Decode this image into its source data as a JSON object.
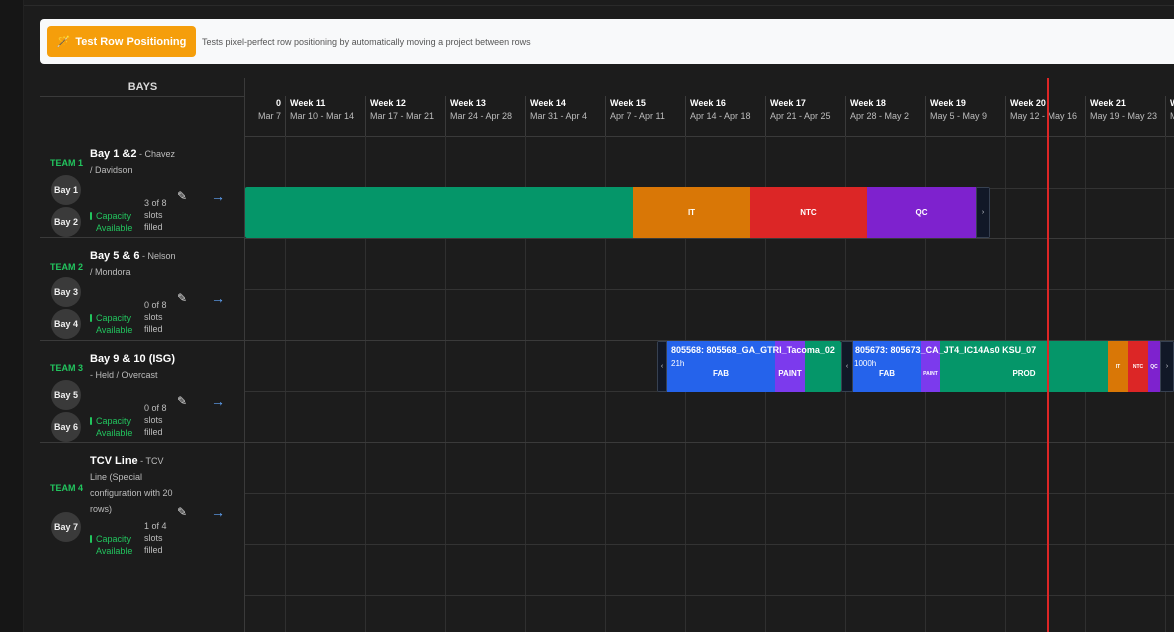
{
  "toolbar": {
    "test_button_label": "Test Row Positioning",
    "test_button_icon": "wand-icon",
    "description": "Tests pixel-perfect row positioning by automatically moving a project between rows"
  },
  "bays_header": "BAYS",
  "weeks": [
    {
      "label": "0",
      "range": "Mar 7"
    },
    {
      "label": "Week 11",
      "range": "Mar 10 - Mar 14"
    },
    {
      "label": "Week 12",
      "range": "Mar 17 - Mar 21"
    },
    {
      "label": "Week 13",
      "range": "Mar 24 - Apr 28"
    },
    {
      "label": "Week 14",
      "range": "Mar 31 - Apr 4"
    },
    {
      "label": "Week 15",
      "range": "Apr 7 - Apr 11"
    },
    {
      "label": "Week 16",
      "range": "Apr 14 - Apr 18"
    },
    {
      "label": "Week 17",
      "range": "Apr 21 - Apr 25"
    },
    {
      "label": "Week 18",
      "range": "Apr 28 - May 2"
    },
    {
      "label": "Week 19",
      "range": "May 5 - May 9"
    },
    {
      "label": "Week 20",
      "range": "May 12 - May 16"
    },
    {
      "label": "Week 21",
      "range": "May 19 - May 23"
    },
    {
      "label": "W",
      "range": "M"
    }
  ],
  "teams": [
    {
      "team": "TEAM 1",
      "bay_name": "Bay 1 &2",
      "bay_desc": "Chavez / Davidson",
      "bays": [
        "Bay 1",
        "Bay 2"
      ],
      "capacity": "Capacity Available",
      "slots": "3 of 8 slots filled"
    },
    {
      "team": "TEAM 2",
      "bay_name": "Bay 5 & 6",
      "bay_desc": "Nelson / Mondora",
      "bays": [
        "Bay 3",
        "Bay 4"
      ],
      "capacity": "Capacity Available",
      "slots": "0 of 8 slots filled"
    },
    {
      "team": "TEAM 3",
      "bay_name": "Bay 9 & 10 (ISG)",
      "bay_desc": "Held / Overcast",
      "bays": [
        "Bay 5",
        "Bay 6"
      ],
      "capacity": "Capacity Available",
      "slots": "0 of 8 slots filled"
    },
    {
      "team": "TEAM 4",
      "bay_name": "TCV Line",
      "bay_desc": "TCV Line (Special configuration with 20 rows)",
      "bays": [
        "Bay 7"
      ],
      "capacity": "Capacity Available",
      "slots": "1 of 4 slots filled"
    }
  ],
  "bars": {
    "team1": {
      "phases": [
        "",
        "IT",
        "NTC",
        "QC"
      ],
      "end_handle": "›"
    },
    "project_a": {
      "name": "805568: 805568_GA_GTRI_Tacoma_02",
      "hours": "21h",
      "phases": [
        "FAB",
        "PAINT",
        ""
      ],
      "start_handle": "‹"
    },
    "project_b": {
      "name": "805673: 805673_CA_JT4_IC14As0 KSU_07",
      "hours": "1000h",
      "phases": [
        "FAB",
        "PAINT",
        "PROD",
        "IT",
        "NTC",
        "QC"
      ],
      "start_handle": "‹",
      "end_handle": "›"
    }
  },
  "colors": {
    "prod": "#059669",
    "it": "#d97706",
    "ntc": "#dc2626",
    "qc": "#7e22ce",
    "fab": "#2563eb",
    "paint": "#7c3aed",
    "team_label": "#22c55e",
    "today_line": "#dc2626",
    "test_button": "#f59e0b"
  }
}
